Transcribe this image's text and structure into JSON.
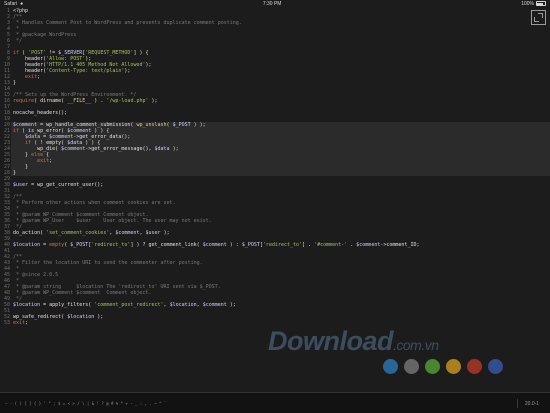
{
  "status": {
    "carrier": "Safari",
    "signal": "●",
    "time": "7:30 PM",
    "battery_pct": "100%"
  },
  "code_lines": [
    [
      [
        "<?php",
        "pl"
      ]
    ],
    [
      [
        "/**",
        "com"
      ]
    ],
    [
      [
        " * Handles Comment Post to WordPress and prevents duplicate comment posting.",
        "com"
      ]
    ],
    [
      [
        " *",
        "com"
      ]
    ],
    [
      [
        " * @package WordPress",
        "com"
      ]
    ],
    [
      [
        " */",
        "com"
      ]
    ],
    [
      [
        "",
        ""
      ]
    ],
    [
      [
        "if",
        "kw"
      ],
      [
        " ( ",
        "pl"
      ],
      [
        "'POST'",
        "str"
      ],
      [
        " != ",
        "pl"
      ],
      [
        "$_SERVER",
        "var"
      ],
      [
        "[",
        "pl"
      ],
      [
        "'REQUEST_METHOD'",
        "str"
      ],
      [
        "] ) {",
        "pl"
      ]
    ],
    [
      [
        "    header(",
        "pl"
      ],
      [
        "'Allow: POST'",
        "str"
      ],
      [
        ");",
        "pl"
      ]
    ],
    [
      [
        "    header(",
        "pl"
      ],
      [
        "'HTTP/1.1 405 Method Not Allowed'",
        "str"
      ],
      [
        ");",
        "pl"
      ]
    ],
    [
      [
        "    header(",
        "pl"
      ],
      [
        "'Content-Type: text/plain'",
        "str"
      ],
      [
        ");",
        "pl"
      ]
    ],
    [
      [
        "    exit",
        "kw"
      ],
      [
        ";",
        "pl"
      ]
    ],
    [
      [
        "}",
        "pl"
      ]
    ],
    [
      [
        "",
        ""
      ]
    ],
    [
      [
        "/** Sets up the WordPress Environment. */",
        "com"
      ]
    ],
    [
      [
        "require",
        "kw"
      ],
      [
        "( dirname( ",
        "pl"
      ],
      [
        "__FILE__",
        "fn"
      ],
      [
        " ) . ",
        "pl"
      ],
      [
        "'/wp-load.php'",
        "str"
      ],
      [
        " );",
        "pl"
      ]
    ],
    [
      [
        "",
        ""
      ]
    ],
    [
      [
        "nocache_headers();",
        "pl"
      ]
    ],
    [
      [
        "",
        ""
      ]
    ],
    [
      [
        "$comment",
        "var"
      ],
      [
        " = wp_handle_comment_submission( ",
        "pl"
      ],
      [
        "wp_unslash",
        "fn"
      ],
      [
        "( ",
        "pl"
      ],
      [
        "$_POST",
        "var"
      ],
      [
        " ) );",
        "pl"
      ]
    ],
    [
      [
        "if",
        "kw"
      ],
      [
        " ( is_wp_error( ",
        "pl"
      ],
      [
        "$comment",
        "var"
      ],
      [
        " ) ) {",
        "pl"
      ]
    ],
    [
      [
        "    ",
        "pl"
      ],
      [
        "$data",
        "var"
      ],
      [
        " = ",
        "pl"
      ],
      [
        "$comment",
        "var"
      ],
      [
        "->get_error_data();",
        "pl"
      ]
    ],
    [
      [
        "    ",
        "pl"
      ],
      [
        "if",
        "kw"
      ],
      [
        " ( ! empty( ",
        "pl"
      ],
      [
        "$data",
        "var"
      ],
      [
        " ) ) {",
        "pl"
      ]
    ],
    [
      [
        "        wp_die( ",
        "pl"
      ],
      [
        "$comment",
        "var"
      ],
      [
        "->get_error_message(), ",
        "pl"
      ],
      [
        "$data",
        "var"
      ],
      [
        " );",
        "pl"
      ]
    ],
    [
      [
        "    } ",
        "pl"
      ],
      [
        "else",
        "kw"
      ],
      [
        " {",
        "pl"
      ]
    ],
    [
      [
        "        exit",
        "kw"
      ],
      [
        ";",
        "pl"
      ]
    ],
    [
      [
        "    }",
        "pl"
      ]
    ],
    [
      [
        "}",
        "pl"
      ]
    ],
    [
      [
        "",
        ""
      ]
    ],
    [
      [
        "$user",
        "var"
      ],
      [
        " = wp_get_current_user();",
        "pl"
      ]
    ],
    [
      [
        "",
        ""
      ]
    ],
    [
      [
        "/**",
        "com"
      ]
    ],
    [
      [
        " * Perform other actions when comment cookies are set.",
        "com"
      ]
    ],
    [
      [
        " *",
        "com"
      ]
    ],
    [
      [
        " * @param WP_Comment $comment Comment object.",
        "com"
      ]
    ],
    [
      [
        " * @param WP_User    $user    User object. The user may not exist.",
        "com"
      ]
    ],
    [
      [
        " */",
        "com"
      ]
    ],
    [
      [
        "do_action( ",
        "pl"
      ],
      [
        "'set_comment_cookies'",
        "str"
      ],
      [
        ", ",
        "pl"
      ],
      [
        "$comment",
        "var"
      ],
      [
        ", ",
        "pl"
      ],
      [
        "$user",
        "var"
      ],
      [
        " );",
        "pl"
      ]
    ],
    [
      [
        "",
        ""
      ]
    ],
    [
      [
        "$location",
        "var"
      ],
      [
        " = ",
        "pl"
      ],
      [
        "empty",
        "kw"
      ],
      [
        "( ",
        "pl"
      ],
      [
        "$_POST",
        "var"
      ],
      [
        "[",
        "pl"
      ],
      [
        "'redirect_to'",
        "str"
      ],
      [
        "] ) ? get_comment_link( ",
        "pl"
      ],
      [
        "$comment",
        "var"
      ],
      [
        " ) : ",
        "pl"
      ],
      [
        "$_POST",
        "var"
      ],
      [
        "[",
        "pl"
      ],
      [
        "'redirect_to'",
        "str"
      ],
      [
        "] . ",
        "pl"
      ],
      [
        "'#comment-'",
        "str"
      ],
      [
        " . ",
        "pl"
      ],
      [
        "$comment",
        "var"
      ],
      [
        "->comment_ID;",
        "pl"
      ]
    ],
    [
      [
        "",
        ""
      ]
    ],
    [
      [
        "/**",
        "com"
      ]
    ],
    [
      [
        " * Filter the location URI to send the commenter after posting.",
        "com"
      ]
    ],
    [
      [
        " *",
        "com"
      ]
    ],
    [
      [
        " * @since 2.0.5",
        "com"
      ]
    ],
    [
      [
        " *",
        "com"
      ]
    ],
    [
      [
        " * @param string     $location The 'redirect_to' URI sent via $_POST.",
        "com"
      ]
    ],
    [
      [
        " * @param WP_Comment $comment  Comment object.",
        "com"
      ]
    ],
    [
      [
        " */",
        "com"
      ]
    ],
    [
      [
        "$location",
        "var"
      ],
      [
        " = apply_filters( ",
        "pl"
      ],
      [
        "'comment_post_redirect'",
        "str"
      ],
      [
        ", ",
        "pl"
      ],
      [
        "$location",
        "var"
      ],
      [
        ", ",
        "pl"
      ],
      [
        "$comment",
        "var"
      ],
      [
        " );",
        "pl"
      ]
    ],
    [
      [
        "",
        ""
      ]
    ],
    [
      [
        "wp_safe_redirect( ",
        "pl"
      ],
      [
        "$location",
        "var"
      ],
      [
        " );",
        "pl"
      ]
    ],
    [
      [
        "exit",
        "kw"
      ],
      [
        ";",
        "pl"
      ]
    ]
  ],
  "watermark": {
    "main": "Download",
    "suffix": ".com.vn"
  },
  "dot_colors": [
    "#2d7fc1",
    "#7d7d7d",
    "#5aa83a",
    "#d9a21e",
    "#c0392b",
    "#3b5bb5"
  ],
  "bottom_bar": {
    "keyboard_row": "— · ( ) [ ] { } ' \" ; $ = < > / \\ | & ! ? @ # % * + - _ : , . ~ ^ `",
    "version": "20.0-1"
  },
  "colors": {
    "background": "#1c1c1c",
    "highlight": "#2b2b2b"
  }
}
